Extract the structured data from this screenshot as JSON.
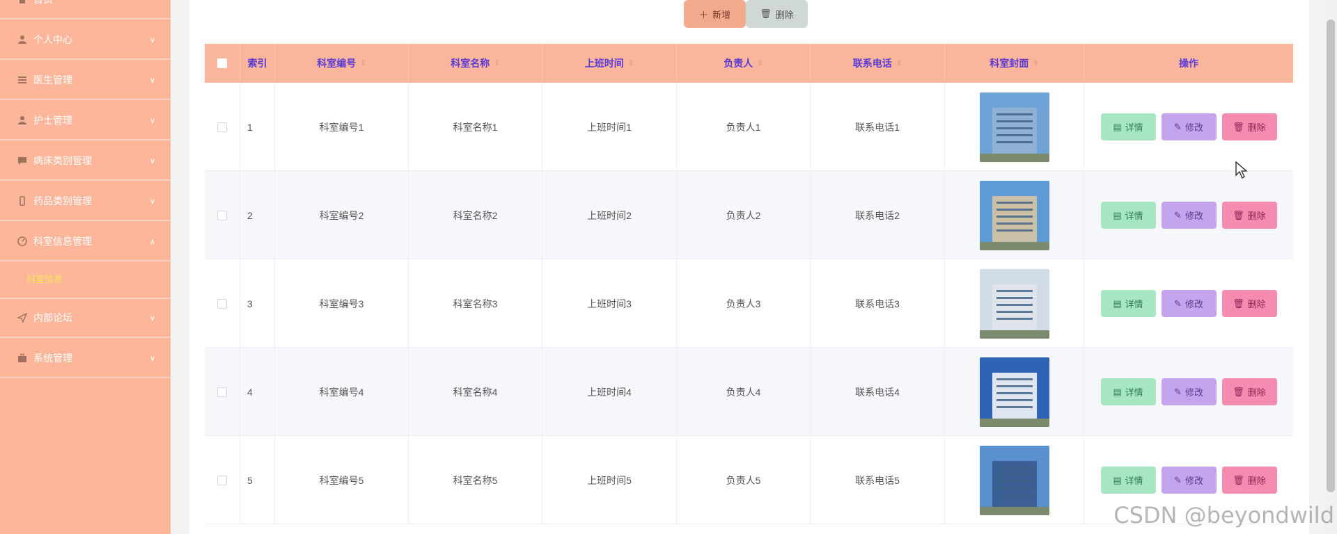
{
  "sidebar": {
    "items": [
      {
        "label": "首页",
        "icon": "home-icon"
      },
      {
        "label": "个人中心",
        "icon": "user-icon"
      },
      {
        "label": "医生管理",
        "icon": "list-icon"
      },
      {
        "label": "护士管理",
        "icon": "user-icon"
      },
      {
        "label": "病床类别管理",
        "icon": "chat-icon"
      },
      {
        "label": "药品类别管理",
        "icon": "phone-icon"
      },
      {
        "label": "科室信息管理",
        "icon": "compass-icon"
      },
      {
        "label": "内部论坛",
        "icon": "send-icon"
      },
      {
        "label": "系统管理",
        "icon": "briefcase-icon"
      }
    ],
    "submenu": {
      "label": "科室信息"
    }
  },
  "toolbar": {
    "add_label": "新增",
    "delete_label": "删除"
  },
  "table": {
    "headers": [
      "索引",
      "科室编号",
      "科室名称",
      "上班时间",
      "负责人",
      "联系电话",
      "科室封面",
      "操作"
    ],
    "rows": [
      {
        "index": "1",
        "code": "科室编号1",
        "name": "科室名称1",
        "time": "上班时间1",
        "person": "负责人1",
        "phone": "联系电话1"
      },
      {
        "index": "2",
        "code": "科室编号2",
        "name": "科室名称2",
        "time": "上班时间2",
        "person": "负责人2",
        "phone": "联系电话2"
      },
      {
        "index": "3",
        "code": "科室编号3",
        "name": "科室名称3",
        "time": "上班时间3",
        "person": "负责人3",
        "phone": "联系电话3"
      },
      {
        "index": "4",
        "code": "科室编号4",
        "name": "科室名称4",
        "time": "上班时间4",
        "person": "负责人4",
        "phone": "联系电话4"
      },
      {
        "index": "5",
        "code": "科室编号5",
        "name": "科室名称5",
        "time": "上班时间5",
        "person": "负责人5",
        "phone": "联系电话5"
      }
    ],
    "actions": {
      "detail": "详情",
      "edit": "修改",
      "delete": "删除"
    }
  },
  "watermark": "CSDN @beyondwild",
  "colors": {
    "sidebar": "#fdb69a",
    "header": "#fab59d",
    "header_text": "#5b3bd6",
    "detail": "#a6e6c2",
    "edit": "#c4a4ec",
    "delete": "#f48cb2"
  }
}
